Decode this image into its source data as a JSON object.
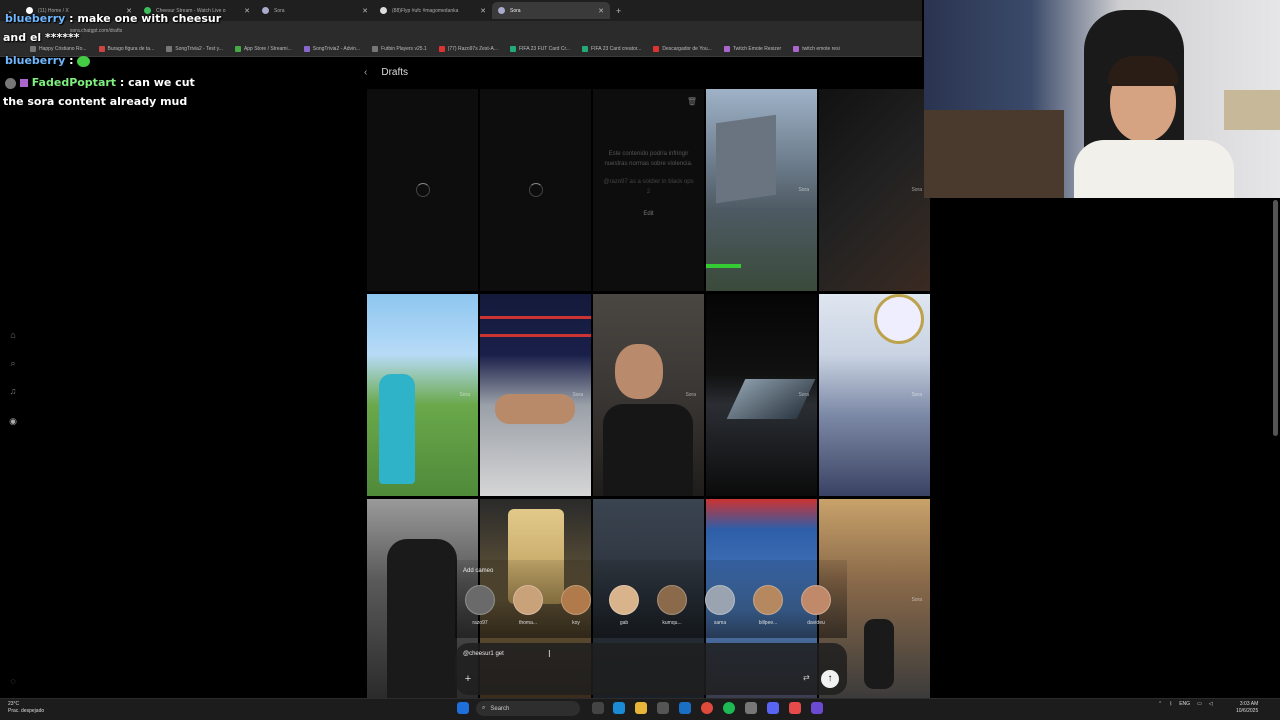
{
  "browser": {
    "tabs": [
      {
        "label": "(11) Home / X",
        "active": false
      },
      {
        "label": "Cheesur Stream - Watch Live o",
        "active": false
      },
      {
        "label": "Sora",
        "active": false
      },
      {
        "label": "(88)Flyp #ufc #magomedanka",
        "active": false
      },
      {
        "label": "Sora",
        "active": true
      }
    ],
    "url": "sora.chatgpt.com/drafts",
    "bookmarks": [
      "Happy Cristiano Ro...",
      "Burago figura de ta...",
      "SongTrivia2 - Test y...",
      "App Store / Streami...",
      "SongTrivia2 - Advin...",
      "Futbin Players v25.1",
      "(77) Razo97s Zest-A...",
      "FIFA 23 FUT Card Cr...",
      "FIFA 23 Card creator...",
      "Descargador de You...",
      "Twitch Emote Resizer",
      "twitch emote resi"
    ]
  },
  "chat": [
    {
      "user": "blueberry",
      "message": ": make one with cheesur"
    },
    {
      "user": "",
      "message": "and el ******"
    },
    {
      "user": "blueberry",
      "message": ":"
    },
    {
      "user": "FadedPoptart",
      "message": ": can we cut"
    },
    {
      "user": "",
      "message": "the sora content already mud"
    }
  ],
  "page": {
    "title": "Drafts",
    "blocked_notice": {
      "text": "Este contenido podría infringir nuestras normas sobre violencia.",
      "sub": "@razo97 as a soldier in black ops 2",
      "edit": "Edit"
    },
    "watermark": "Sora"
  },
  "cameo": {
    "label": "Add cameo",
    "people": [
      {
        "name": "razo97",
        "color": "#6a6a6a"
      },
      {
        "name": "thoma...",
        "color": "#c9a27a"
      },
      {
        "name": "koy",
        "color": "#b07a4a"
      },
      {
        "name": "gab",
        "color": "#d9b38c"
      },
      {
        "name": "kumqu...",
        "color": "#8a6a4a"
      },
      {
        "name": "sama",
        "color": "#9aa4b0"
      },
      {
        "name": "billpee...",
        "color": "#b58860"
      },
      {
        "name": "davideu",
        "color": "#c08a6a"
      }
    ]
  },
  "prompt": {
    "value": "@cheesur1 get",
    "cursor": "I"
  },
  "taskbar": {
    "weather_temp": "23°C",
    "weather_desc": "Prac. despejado",
    "search_label": "Search",
    "language": "ENG",
    "time": "3:03 AM",
    "date": "10/6/2025"
  }
}
